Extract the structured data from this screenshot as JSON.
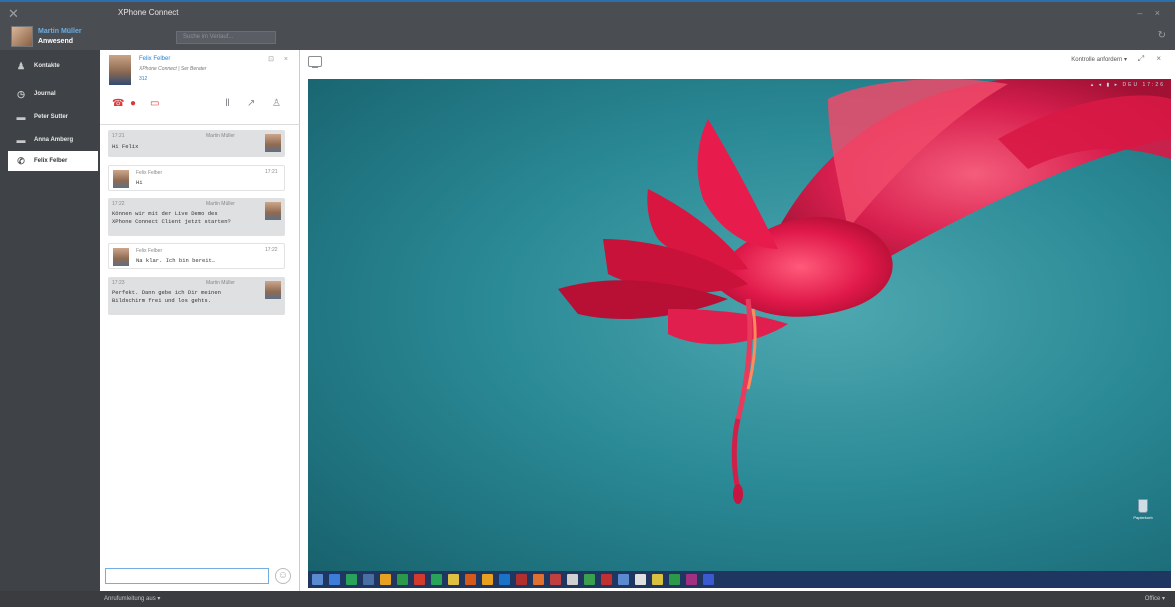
{
  "app": {
    "title": "XPhone Connect",
    "search_placeholder": "Suche im Verlauf...",
    "window_controls": "– ×",
    "refresh_icon": "refresh-icon"
  },
  "user": {
    "name": "Martin Müller",
    "status": "Anwesend"
  },
  "sidebar": {
    "items": [
      {
        "label": "Kontakte",
        "icon": "contacts-icon"
      },
      {
        "label": "Journal",
        "icon": "clock-icon"
      },
      {
        "label": "Peter Sutter",
        "icon": "chat-icon"
      },
      {
        "label": "Anna Amberg",
        "icon": "chat-icon"
      },
      {
        "label": "Felix Felber",
        "icon": "phone-icon",
        "active": true
      }
    ]
  },
  "contact": {
    "name": "Felix Felber",
    "subtitle": "XPhone Connect | Ser Berater",
    "extension": "312",
    "header_icons": "⊡ ×"
  },
  "messages": [
    {
      "dir": "out",
      "time": "17:21",
      "who": "Martin Müller",
      "text": "Hi Felix"
    },
    {
      "dir": "in",
      "time": "17:21",
      "who": "Felix Felber",
      "text": "Hi"
    },
    {
      "dir": "out",
      "time": "17:22",
      "who": "Martin Müller",
      "text": "Können wir mit der Live Demo des\nXPhone Connect Client jetzt starten?"
    },
    {
      "dir": "in",
      "time": "17:22",
      "who": "Felix Felber",
      "text": "Na klar. Ich bin bereit…"
    },
    {
      "dir": "out",
      "time": "17:23",
      "who": "Martin Müller",
      "text": "Perfekt. Dann gebe ich Dir meinen\nBildschirm frei und los gehts."
    }
  ],
  "pane": {
    "control_label": "Kontrolle anfordern ▾",
    "window_icons": "⤢ ×"
  },
  "desktop": {
    "recycle_bin": "Papierkorb",
    "tray_text": "▴ ◂ ▮ ▸ DEU 17:26",
    "taskbar_colors": [
      "#3b7dd8",
      "#2aa35a",
      "#4a6fa5",
      "#e8a020",
      "#2a9a4a",
      "#d23b2b",
      "#2aa35a",
      "#e0c040",
      "#d35a1a",
      "#e8a020",
      "#1a73c8",
      "#b03030",
      "#e07030",
      "#c04040",
      "#d0d0d0",
      "#3aa050",
      "#c03030",
      "#5a8ad0",
      "#e0e0e0",
      "#d8c040",
      "#2a9a4a",
      "#a03080",
      "#3a5ad0"
    ]
  },
  "statusbar": {
    "left": "Anrufumleitung aus ▾",
    "right": "Office ▾"
  }
}
